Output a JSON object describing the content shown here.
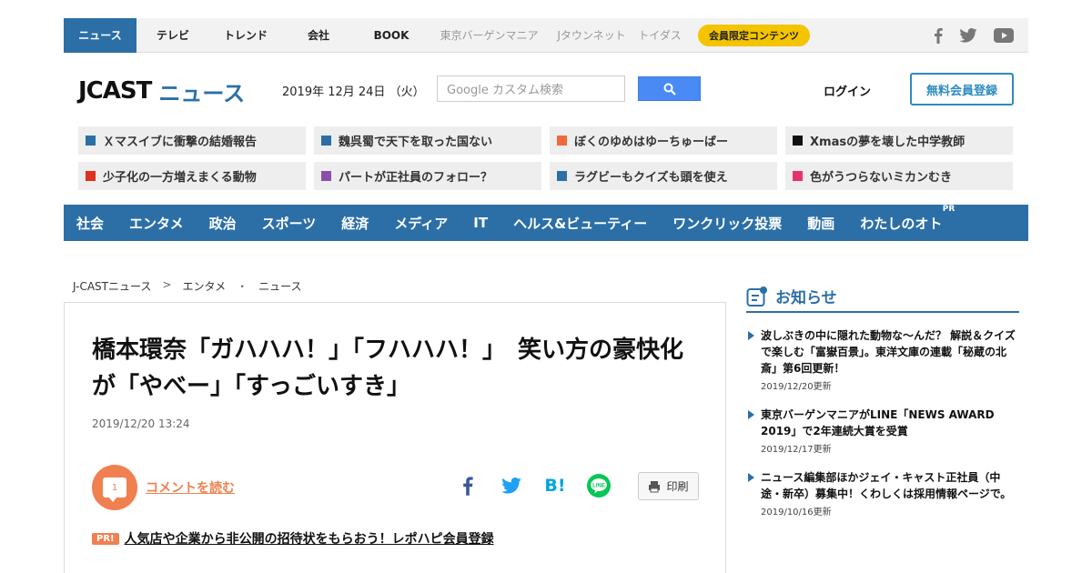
{
  "topnav": {
    "tabs": [
      {
        "label": "ニュース",
        "state": "active"
      },
      {
        "label": "テレビ",
        "state": "normal"
      },
      {
        "label": "トレンド",
        "state": "normal"
      },
      {
        "label": "会社",
        "state": "normal"
      },
      {
        "label": "BOOK",
        "state": "normal"
      },
      {
        "label": "東京バーゲンマニア",
        "state": "muted"
      },
      {
        "label": "Jタウンネット",
        "state": "muted"
      },
      {
        "label": "トイダス",
        "state": "muted"
      }
    ],
    "member_pill": "会員限定コンテンツ",
    "social_icons": [
      "facebook-icon",
      "twitter-icon",
      "youtube-icon"
    ]
  },
  "header": {
    "logo_main": "JCAST",
    "logo_sub": "ニュース",
    "date": "2019年 12月 24日 （火）",
    "search_placeholder": "Google カスタム検索",
    "login": "ログイン",
    "register": "無料会員登録"
  },
  "trend_tags": [
    {
      "label": "Ｘマスイブに衝撃の結婚報告",
      "color": "#2c6fa6"
    },
    {
      "label": "魏呉蜀で天下を取った国ない",
      "color": "#2c6fa6"
    },
    {
      "label": "ぼくのゆめはゆーちゅーばー",
      "color": "#f06a3c"
    },
    {
      "label": "Xmasの夢を壊した中学教師",
      "color": "#111111"
    },
    {
      "label": "少子化の一方増えまくる動物",
      "color": "#e03020"
    },
    {
      "label": "パートが正社員のフォロー？",
      "color": "#8b4fa8"
    },
    {
      "label": "ラグビーもクイズも頭を使え",
      "color": "#2c6fa6"
    },
    {
      "label": "色がうつらないミカンむき",
      "color": "#e8336a"
    }
  ],
  "categories": [
    "社会",
    "エンタメ",
    "政治",
    "スポーツ",
    "経済",
    "メディア",
    "IT",
    "ヘルス&ビューティー",
    "ワンクリック投票",
    "動画",
    "わたしのオト"
  ],
  "categories_pr": "PR",
  "breadcrumb": [
    "J-CASTニュース",
    "エンタメ",
    "ニュース"
  ],
  "breadcrumb_seps": [
    ">",
    "・"
  ],
  "article": {
    "title": "橋本環奈「ガハハハ！」「フハハハ！」　笑い方の豪快化が「やべー」「すっごいすき」",
    "date": "2019/12/20 13:24",
    "comment_count": "1",
    "comment_link": "コメントを読む",
    "share_icons": [
      "facebook-share-icon",
      "twitter-share-icon",
      "hatena-bookmark-icon",
      "line-share-icon"
    ],
    "hatena_label": "B!",
    "line_label": "LINE",
    "print_label": "印刷",
    "pr_badge": "PR!",
    "pr_link": "人気店や企業から非公開の招待状をもらおう！レポハピ会員登録"
  },
  "sidebar": {
    "heading": "お知らせ",
    "notices": [
      {
        "text": "波しぶきの中に隠れた動物な～んだ？ 解説＆クイズで楽しむ「富嶽百景」。東洋文庫の連載「秘蔵の北斎」第6回更新！",
        "date": "2019/12/20更新"
      },
      {
        "text": "東京バーゲンマニアがLINE「NEWS AWARD 2019」で2年連続大賞を受賞",
        "date": "2019/12/17更新"
      },
      {
        "text": "ニュース編集部ほかジェイ・キャスト正社員（中途・新卒）募集中！くわしくは採用情報ページで。",
        "date": "2019/10/16更新"
      }
    ]
  },
  "colors": {
    "brand_blue": "#2c6fa6",
    "accent_orange": "#f08050",
    "pill_yellow": "#f4c400",
    "search_blue": "#4a8af4"
  }
}
